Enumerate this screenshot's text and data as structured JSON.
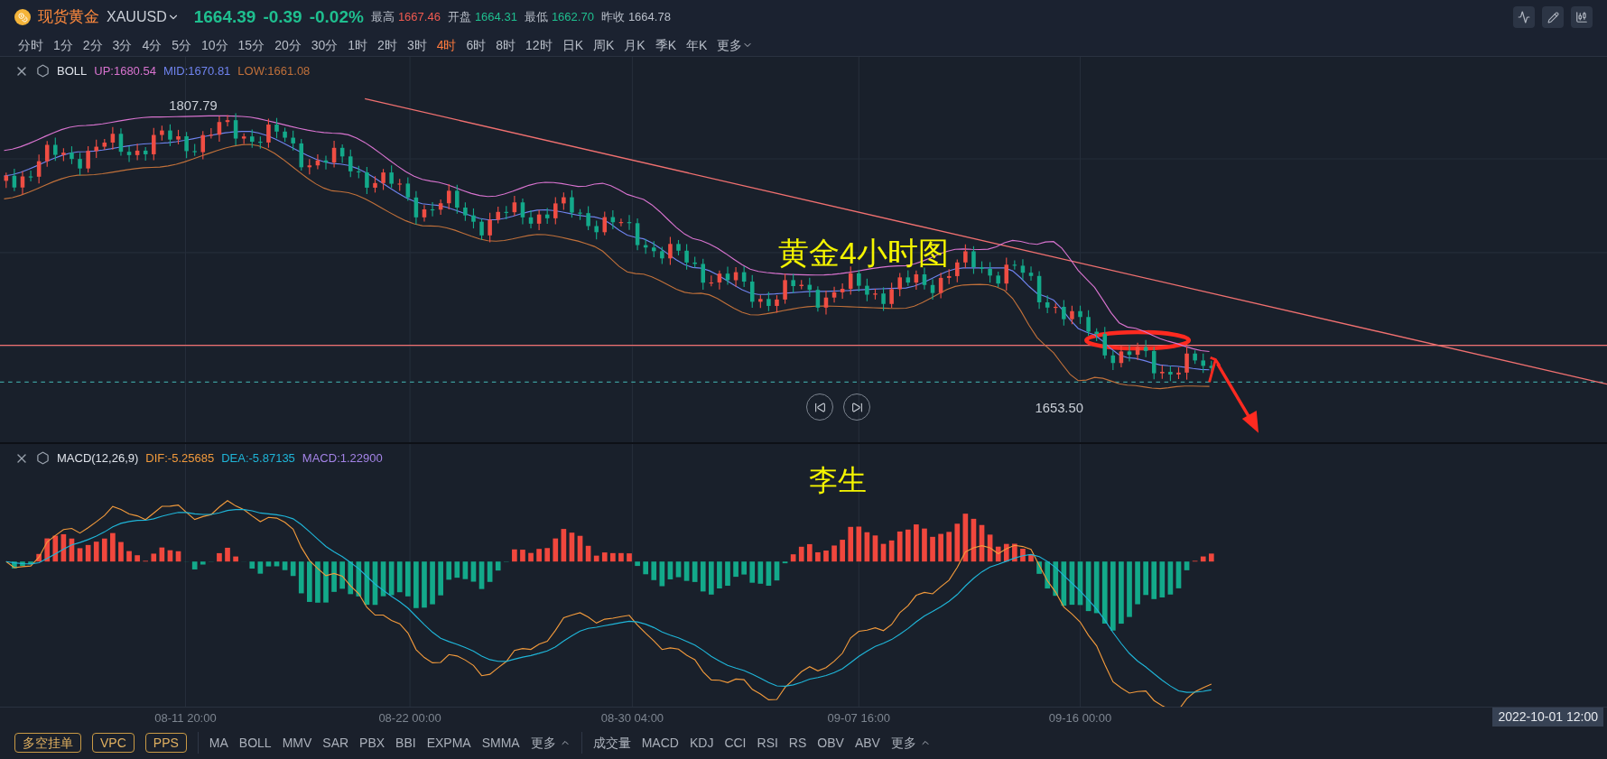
{
  "header": {
    "name": "现货黄金",
    "symbol": "XAUUSD",
    "price": "1664.39",
    "change": "-0.39",
    "change_pct": "-0.02%",
    "stats": [
      {
        "label": "最高",
        "value": "1667.46",
        "kind": "up"
      },
      {
        "label": "开盘",
        "value": "1664.31",
        "kind": "down"
      },
      {
        "label": "最低",
        "value": "1662.70",
        "kind": "down"
      },
      {
        "label": "昨收",
        "value": "1664.78",
        "kind": "flat"
      }
    ]
  },
  "periods": [
    {
      "label": "分时",
      "selected": false
    },
    {
      "label": "1分",
      "selected": false
    },
    {
      "label": "2分",
      "selected": false
    },
    {
      "label": "3分",
      "selected": false
    },
    {
      "label": "4分",
      "selected": false
    },
    {
      "label": "5分",
      "selected": false
    },
    {
      "label": "10分",
      "selected": false
    },
    {
      "label": "15分",
      "selected": false
    },
    {
      "label": "20分",
      "selected": false
    },
    {
      "label": "30分",
      "selected": false
    },
    {
      "label": "1时",
      "selected": false
    },
    {
      "label": "2时",
      "selected": false
    },
    {
      "label": "3时",
      "selected": false
    },
    {
      "label": "4时",
      "selected": true
    },
    {
      "label": "6时",
      "selected": false
    },
    {
      "label": "8时",
      "selected": false
    },
    {
      "label": "12时",
      "selected": false
    },
    {
      "label": "日K",
      "selected": false
    },
    {
      "label": "周K",
      "selected": false
    },
    {
      "label": "月K",
      "selected": false
    },
    {
      "label": "季K",
      "selected": false
    },
    {
      "label": "年K",
      "selected": false
    }
  ],
  "period_more": "更多",
  "main_indicator": {
    "name": "BOLL",
    "values": [
      {
        "text": "UP:1680.54",
        "color": "#d873cf"
      },
      {
        "text": "MID:1670.81",
        "color": "#6f83ee"
      },
      {
        "text": "LOW:1661.08",
        "color": "#c0703a"
      }
    ],
    "high_label": "1807.79",
    "low_label": "1653.50",
    "note": "黄金4小时图"
  },
  "sub_indicator": {
    "name": "MACD(12,26,9)",
    "values": [
      {
        "text": "DIF:-5.25685",
        "color": "#f29a3c"
      },
      {
        "text": "DEA:-5.87135",
        "color": "#1fb5d8"
      },
      {
        "text": "MACD:1.22900",
        "color": "#a383e6"
      }
    ],
    "note": "李生"
  },
  "x_axis": [
    "08-11 20:00",
    "08-22 00:00",
    "08-30 04:00",
    "09-07 16:00",
    "09-16 00:00"
  ],
  "crosshair_time": "2022-10-01 12:00",
  "bottom": {
    "buttons": [
      "多空挂单",
      "VPC",
      "PPS"
    ],
    "main_indicators": [
      "MA",
      "BOLL",
      "MMV",
      "SAR",
      "PBX",
      "BBI",
      "EXPMA",
      "SMMA"
    ],
    "main_more": "更多",
    "sub_indicators": [
      "成交量",
      "MACD",
      "KDJ",
      "CCI",
      "RSI",
      "RS",
      "OBV",
      "ABV"
    ],
    "sub_more": "更多"
  }
}
